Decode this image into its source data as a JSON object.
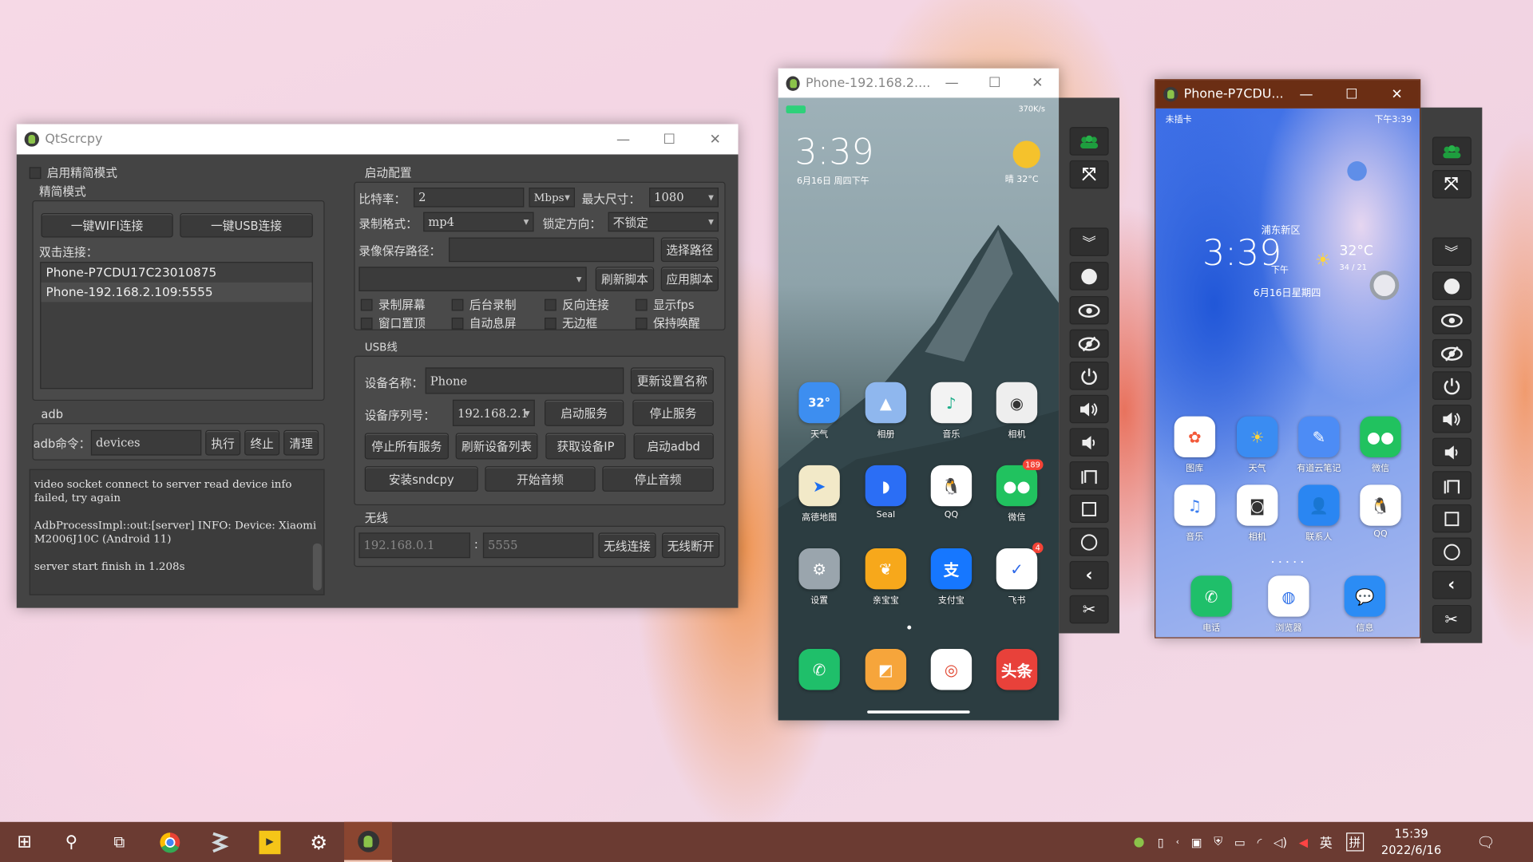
{
  "qtscrcpy": {
    "title": "QtScrcpy",
    "simple_mode_checkbox": "启用精简模式",
    "simple_mode_group": "精简模式",
    "wifi_connect": "一键WIFI连接",
    "usb_connect": "一键USB连接",
    "double_click_label": "双击连接：",
    "devices": [
      "Phone-P7CDU17C23010875",
      "Phone-192.168.2.109:5555"
    ],
    "selected_device_index": 1,
    "adb_group": "adb",
    "adb_cmd_label": "adb命令：",
    "adb_cmd_value": "devices",
    "adb_exec": "执行",
    "adb_stop": "终止",
    "adb_clear": "清理",
    "log": [
      "video socket connect to server read device info failed, try again",
      "AdbProcessImpl::out:[server] INFO: Device: Xiaomi M2006J10C (Android 11)",
      "server start finish in 1.208s"
    ],
    "start_config": {
      "title": "启动配置",
      "bitrate_label": "比特率：",
      "bitrate_value": "2",
      "bitrate_unit": "Mbps",
      "max_size_label": "最大尺寸：",
      "max_size_value": "1080",
      "record_format_label": "录制格式：",
      "record_format_value": "mp4",
      "lock_orientation_label": "锁定方向：",
      "lock_orientation_value": "不锁定",
      "record_path_label": "录像保存路径：",
      "record_path_value": "",
      "choose_path": "选择路径",
      "script_value": "",
      "refresh_script": "刷新脚本",
      "apply_script": "应用脚本",
      "checkboxes": [
        {
          "label": "录制屏幕",
          "checked": false
        },
        {
          "label": "后台录制",
          "checked": false
        },
        {
          "label": "反向连接",
          "checked": false
        },
        {
          "label": "显示fps",
          "checked": false
        },
        {
          "label": "窗口置顶",
          "checked": false
        },
        {
          "label": "自动息屏",
          "checked": false
        },
        {
          "label": "无边框",
          "checked": false
        },
        {
          "label": "保持唤醒",
          "checked": false
        }
      ]
    },
    "usb": {
      "title": "USB线",
      "device_name_label": "设备名称：",
      "device_name_value": "Phone",
      "update_name": "更新设置名称",
      "serial_label": "设备序列号：",
      "serial_value": "192.168.2.1",
      "start_service": "启动服务",
      "stop_service": "停止服务",
      "stop_all": "停止所有服务",
      "refresh_devices": "刷新设备列表",
      "get_ip": "获取设备IP",
      "start_adbd": "启动adbd",
      "install_sndcpy": "安装sndcpy",
      "start_audio": "开始音频",
      "stop_audio": "停止音频"
    },
    "wireless": {
      "title": "无线",
      "ip_placeholder": "192.168.0.1",
      "port_placeholder": "5555",
      "sep": ":",
      "connect": "无线连接",
      "disconnect": "无线断开"
    }
  },
  "phone1": {
    "title": "Phone-192.168.2....",
    "status_right": "370K/s",
    "clock": "3:39",
    "date": "6月16日 周四下午",
    "weather": "晴 32°C",
    "apps": [
      {
        "label": "天气",
        "glyph": "32°",
        "color": "#3d8ef0"
      },
      {
        "label": "相册",
        "glyph": "▲",
        "color": "#8fb7ee"
      },
      {
        "label": "音乐",
        "glyph": "♪",
        "color": "#f3f3f3",
        "fg": "#1fae8a"
      },
      {
        "label": "相机",
        "glyph": "◉",
        "color": "#eeeeee",
        "fg": "#333"
      },
      {
        "label": "高德地图",
        "glyph": "➤",
        "color": "#f2e9c8",
        "fg": "#1e6ff0"
      },
      {
        "label": "Seal",
        "glyph": "◗",
        "color": "#2b6ef5"
      },
      {
        "label": "QQ",
        "glyph": "🐧",
        "color": "#ffffff",
        "fg": "#000"
      },
      {
        "label": "微信",
        "glyph": "●●",
        "color": "#21c25f",
        "badge": "189"
      },
      {
        "label": "设置",
        "glyph": "⚙",
        "color": "#9aa5ad"
      },
      {
        "label": "亲宝宝",
        "glyph": "❦",
        "color": "#f7a81b"
      },
      {
        "label": "支付宝",
        "glyph": "支",
        "color": "#1677ff"
      },
      {
        "label": "飞书",
        "glyph": "✓",
        "color": "#ffffff",
        "fg": "#2b67e8",
        "badge": "4"
      }
    ],
    "dock": [
      {
        "name": "phone",
        "glyph": "✆",
        "color": "#1fbf6a"
      },
      {
        "name": "notes",
        "glyph": "◩",
        "color": "#f6a53b"
      },
      {
        "name": "chrome-beta",
        "glyph": "◎",
        "color": "#ffffff",
        "fg": "#e0442f"
      },
      {
        "name": "toutiao",
        "glyph": "头条",
        "color": "#e8413a"
      }
    ]
  },
  "phone2": {
    "title": "Phone-P7CDU...",
    "status_left": "未插卡",
    "status_right": "下午3:39",
    "location": "浦东新区",
    "clock": "3:39",
    "ampm": "下午",
    "temp": "32°C",
    "range": "34 / 21",
    "date": "6月16日星期四",
    "apps": [
      {
        "label": "图库",
        "glyph": "✿",
        "color": "#ffffff",
        "fg": "#f35a3a"
      },
      {
        "label": "天气",
        "glyph": "☀",
        "color": "#3a8cf2",
        "fg": "#ffd43b"
      },
      {
        "label": "有道云笔记",
        "glyph": "✎",
        "color": "#4d8cf5"
      },
      {
        "label": "微信",
        "glyph": "●●",
        "color": "#21c25f"
      },
      {
        "label": "音乐",
        "glyph": "♫",
        "color": "#ffffff",
        "fg": "#3a7df0"
      },
      {
        "label": "相机",
        "glyph": "◙",
        "color": "#ffffff",
        "fg": "#333"
      },
      {
        "label": "联系人",
        "glyph": "👤",
        "color": "#2a86f2"
      },
      {
        "label": "QQ",
        "glyph": "🐧",
        "color": "#ffffff",
        "fg": "#000"
      }
    ],
    "dock": [
      {
        "label": "电话",
        "glyph": "✆",
        "color": "#1fbf6a"
      },
      {
        "label": "浏览器",
        "glyph": "◍",
        "color": "#ffffff",
        "fg": "#2a6ee8"
      },
      {
        "label": "信息",
        "glyph": "💬",
        "color": "#2b8cf5"
      }
    ]
  },
  "toolbar_buttons": [
    "group-control",
    "fullscreen",
    "expand-notification",
    "screen-off",
    "show-touches",
    "hide-touches",
    "power",
    "volume-up",
    "volume-down",
    "app-switch",
    "home",
    "home-circle",
    "back",
    "screenshot"
  ],
  "taskbar": {
    "apps": [
      "start",
      "search",
      "task-view",
      "chrome",
      "app-2",
      "player",
      "settings",
      "qtscrcpy"
    ],
    "ime": "英",
    "time": "15:39",
    "date": "2022/6/16"
  },
  "colors": {
    "qt_bg": "#444444",
    "active_title": "#6b2e14",
    "taskbar": "#6b3b32",
    "accent_green": "#1e9e3e"
  }
}
